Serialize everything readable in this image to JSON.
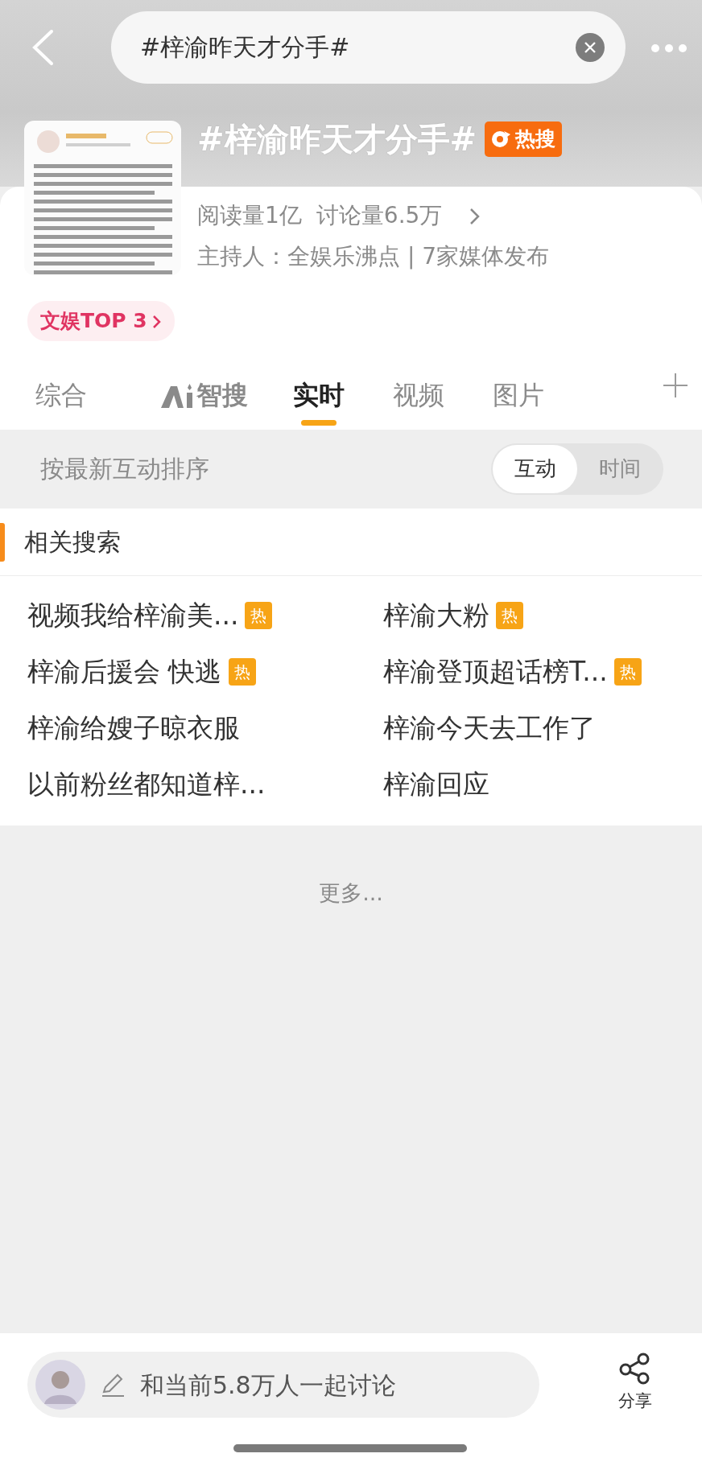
{
  "search": {
    "value": "#梓渝昨天才分手#"
  },
  "topic": {
    "title": "#梓渝昨天才分手#",
    "badge": "热搜",
    "reads": "阅读量1亿",
    "discussions": "讨论量6.5万",
    "host": "主持人：全娱乐沸点 | 7家媒体发布",
    "rank": "文娱TOP 3"
  },
  "tabs": [
    {
      "label": "综合",
      "selected": false,
      "kind": "text"
    },
    {
      "label": "智搜",
      "selected": false,
      "kind": "ai"
    },
    {
      "label": "实时",
      "selected": true,
      "kind": "text"
    },
    {
      "label": "视频",
      "selected": false,
      "kind": "text"
    },
    {
      "label": "图片",
      "selected": false,
      "kind": "text"
    }
  ],
  "sort": {
    "label": "按最新互动排序",
    "options": [
      {
        "label": "互动",
        "selected": true
      },
      {
        "label": "时间",
        "selected": false
      }
    ]
  },
  "related": {
    "title": "相关搜索",
    "items": [
      {
        "text": "视频我给梓渝美...",
        "hot": true,
        "badge": "热"
      },
      {
        "text": "梓渝大粉",
        "hot": true,
        "badge": "热"
      },
      {
        "text": "梓渝后援会 快逃",
        "hot": true,
        "badge": "热"
      },
      {
        "text": "梓渝登顶超话榜T...",
        "hot": true,
        "badge": "热"
      },
      {
        "text": "梓渝给嫂子晾衣服",
        "hot": false
      },
      {
        "text": "梓渝今天去工作了",
        "hot": false
      },
      {
        "text": "以前粉丝都知道梓...",
        "hot": false
      },
      {
        "text": "梓渝回应",
        "hot": false
      }
    ]
  },
  "more": "更多...",
  "composer": {
    "placeholder": "和当前5.8万人一起讨论"
  },
  "share": "分享"
}
